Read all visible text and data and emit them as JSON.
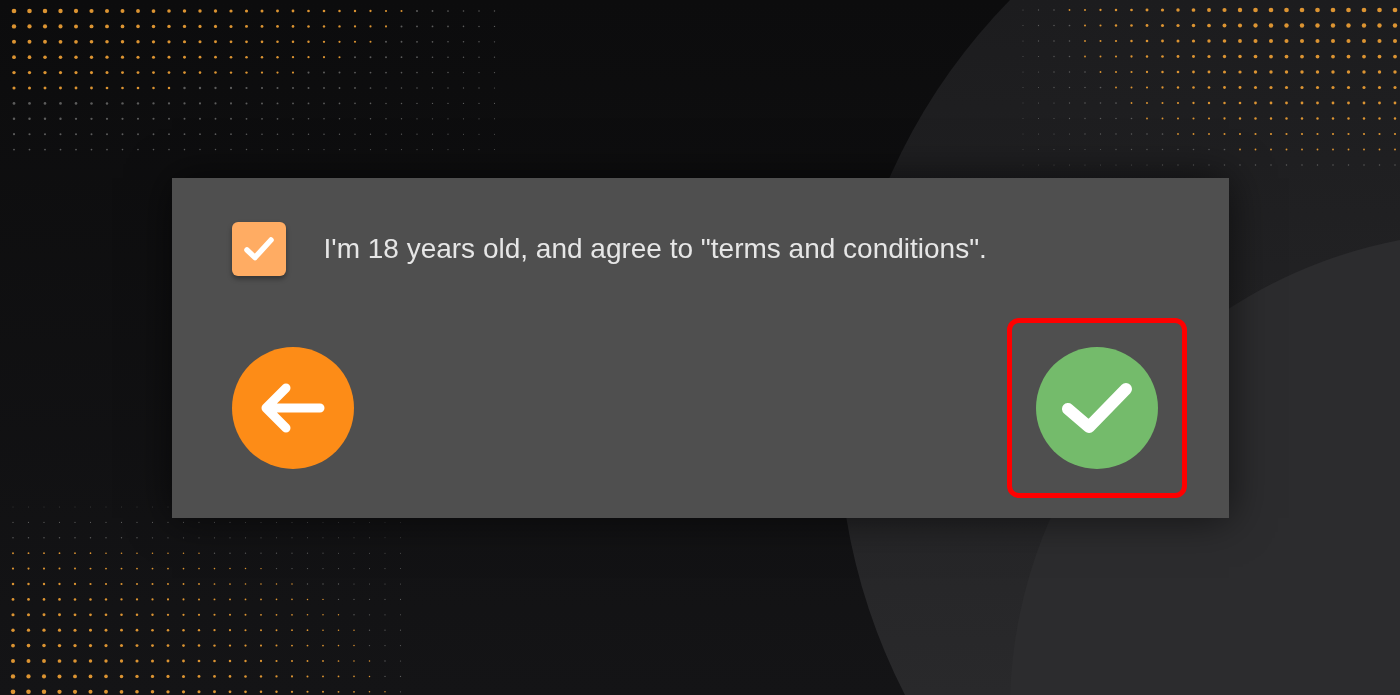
{
  "agreement": {
    "checked": true,
    "label": "I'm 18 years old, and agree to \"terms and conditions\"."
  },
  "buttons": [
    {
      "kind": "back",
      "highlighted": false
    },
    {
      "kind": "confirm",
      "highlighted": true
    }
  ]
}
